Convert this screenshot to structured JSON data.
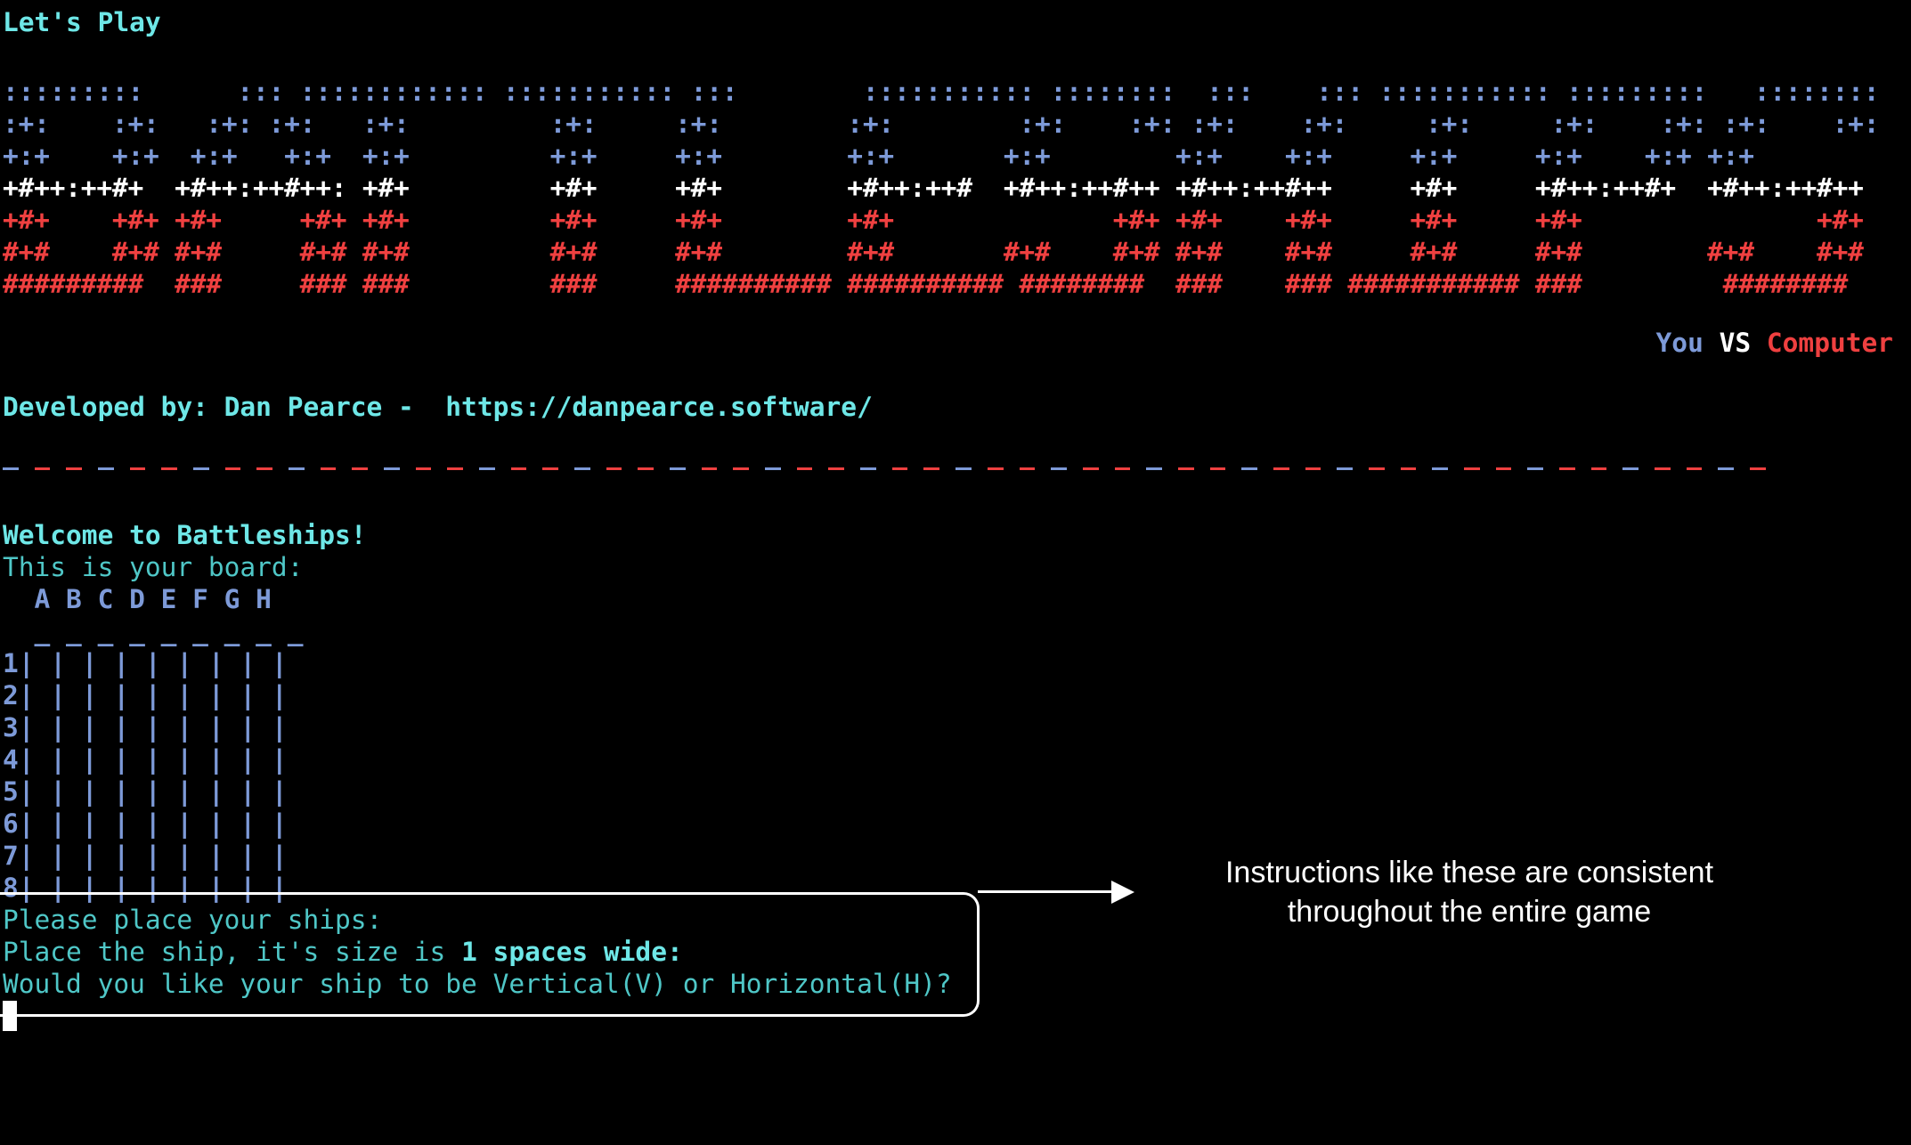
{
  "header": {
    "title": "Let's Play"
  },
  "banner": {
    "lines": [
      {
        "color": "blue",
        "text": ":::::::::      ::: :::::::::::: ::::::::::: :::        ::::::::::: ::::::::  :::    ::: ::::::::::: :::::::::   ::::::::"
      },
      {
        "color": "blue",
        "text": ":+:    :+:   :+: :+:   :+:         :+:     :+:        :+:        :+:    :+: :+:    :+:     :+:     :+:    :+: :+:    :+:"
      },
      {
        "color": "blue",
        "text": "+:+    +:+  +:+   +:+  +:+         +:+     +:+        +:+       +:+        +:+    +:+     +:+     +:+    +:+ +:+"
      },
      {
        "color": "white",
        "text": "+#++:++#+  +#++:++#++: +#+         +#+     +#+        +#++:++#  +#++:++#++ +#++:++#++     +#+     +#++:++#+  +#++:++#++"
      },
      {
        "color": "red",
        "text": "+#+    +#+ +#+     +#+ +#+         +#+     +#+        +#+              +#+ +#+    +#+     +#+     +#+               +#+"
      },
      {
        "color": "red",
        "text": "#+#    #+# #+#     #+# #+#         #+#     #+#        #+#       #+#    #+# #+#    #+#     #+#     #+#        #+#    #+#"
      },
      {
        "color": "red",
        "text": "#########  ###     ### ###         ###     ########## ########## ########  ###    ### ########### ###         ########"
      }
    ]
  },
  "versus": {
    "you": "You",
    "vs": "VS",
    "computer": "Computer"
  },
  "credits": {
    "label": "Developed by: Dan Pearce -  https://danpearce.software/"
  },
  "welcome": {
    "title": "Welcome to Battleships!",
    "board_intro": "This is your board:"
  },
  "board": {
    "columns": [
      "A",
      "B",
      "C",
      "D",
      "E",
      "F",
      "G",
      "H"
    ],
    "rows": [
      "1",
      "2",
      "3",
      "4",
      "5",
      "6",
      "7",
      "8"
    ]
  },
  "prompt": {
    "line1": "Please place your ships:",
    "line2_pre": "Place the ship, it's size is ",
    "line2_bold": "1 spaces wide:",
    "line3": "Would you like your ship to be Vertical(V) or Horizontal(H)?"
  },
  "annotation": {
    "text": "Instructions like these are consistent throughout the entire game"
  },
  "colors": {
    "cyan": "#6ee7e7",
    "blue": "#7d9ad8",
    "red": "#ef4040",
    "background": "#000000"
  }
}
